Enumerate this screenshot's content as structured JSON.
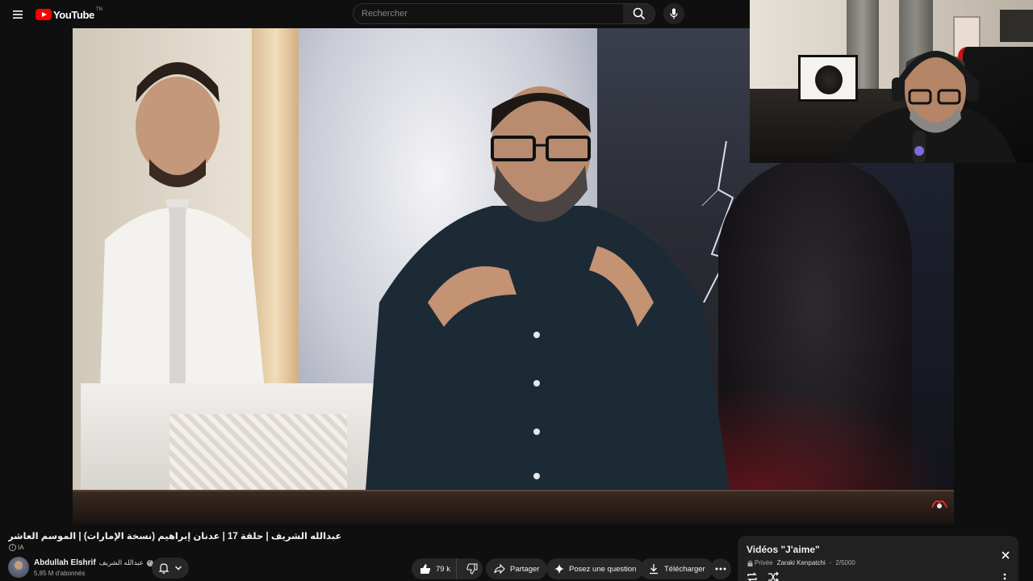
{
  "header": {
    "logo_text": "YouTube",
    "logo_region": "TN",
    "menu_icon": "hamburger-menu-icon",
    "search": {
      "placeholder": "Rechercher",
      "value": ""
    },
    "search_icon": "search-icon",
    "mic_icon": "microphone-icon"
  },
  "video": {
    "title": "عبدالله الشريف | حلقة 17 | عدنان إبراهيم (نسخة الإمارات) | الموسم العاشر",
    "ai_badge": "IA",
    "watermark_icon": "channel-watermark-icon"
  },
  "channel": {
    "name": "Abdullah Elshrif",
    "name_ar": "عبدالله الشريف",
    "subscribers": "5,85 M d'abonnés",
    "bell_icon": "notification-bell-icon"
  },
  "actions": {
    "likes": "79 k",
    "share": "Partager",
    "ask": "Posez une question",
    "download": "Télécharger"
  },
  "playlist": {
    "title": "Vidéos \"J'aime\"",
    "privacy": "Privée",
    "owner": "Zaraki Kenpatchi",
    "position": "2/5000"
  },
  "colors": {
    "background": "#0f0f0f",
    "brand_red": "#ff0000",
    "pill_bg": "#272727",
    "panel_bg": "#212121"
  }
}
